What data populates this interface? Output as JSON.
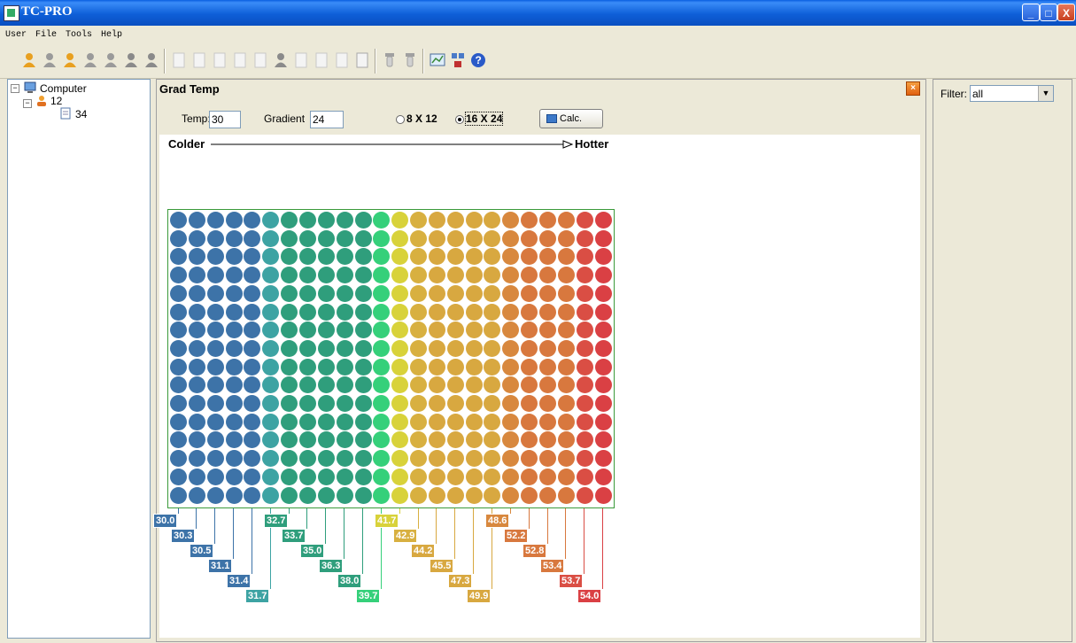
{
  "window": {
    "title": "TC-PRO",
    "min": "_",
    "max": "□",
    "close": "X"
  },
  "menu": {
    "items": [
      "User",
      "File",
      "Tools",
      "Help"
    ]
  },
  "toolbar": {
    "groups": [
      [
        "user-icon",
        "user-gray-icon",
        "add-user-icon",
        "edit-user-icon",
        "user-gray-icon",
        "group-icon",
        "delete-user-icon"
      ],
      [
        "doc-icon",
        "doc-icon",
        "doc-icon",
        "doc-edit-icon",
        "copy-doc-icon",
        "paste-icon",
        "doc-delete-icon",
        "doc-icon",
        "doc-icon",
        "save-icon"
      ],
      [
        "device-icon",
        "device-icon"
      ],
      [
        "chart-icon",
        "network-icon",
        "help-icon"
      ]
    ]
  },
  "tree": {
    "root": "Computer",
    "child": "12",
    "leaf": "34"
  },
  "panel": {
    "title": "Grad Temp",
    "temp_label": "Temp:",
    "temp_value": "30",
    "gradient_label": "Gradient",
    "gradient_value": "24",
    "option_a": "8 X 12",
    "option_b": "16 X 24",
    "selected_option": "16 X 24",
    "calc_label": "Calc.",
    "colder_label": "Colder",
    "hotter_label": "Hotter"
  },
  "plate": {
    "rows": 16,
    "cols": 24,
    "column_colors": [
      "#3d73a8",
      "#3d73a8",
      "#3d73a8",
      "#3d73a8",
      "#3d73a8",
      "#3da3a3",
      "#2f9e7c",
      "#2f9e7c",
      "#2f9e7c",
      "#2f9e7c",
      "#2f9e7c",
      "#35d07a",
      "#d8d23a",
      "#d8b040",
      "#d8a840",
      "#d8a840",
      "#d8a840",
      "#d8a840",
      "#d8883e",
      "#d8783e",
      "#d8783e",
      "#d8783e",
      "#da4e44",
      "#da4044"
    ],
    "temps": [
      "30.0",
      "30.3",
      "30.5",
      "31.1",
      "31.4",
      "31.7",
      "32.7",
      "33.7",
      "35.0",
      "36.3",
      "38.0",
      "39.7",
      "41.7",
      "42.9",
      "44.2",
      "45.5",
      "47.3",
      "49.9",
      "48.6",
      "52.2",
      "52.8",
      "53.4",
      "53.7",
      "54.0"
    ]
  },
  "filter": {
    "label": "Filter:",
    "value": "all"
  }
}
